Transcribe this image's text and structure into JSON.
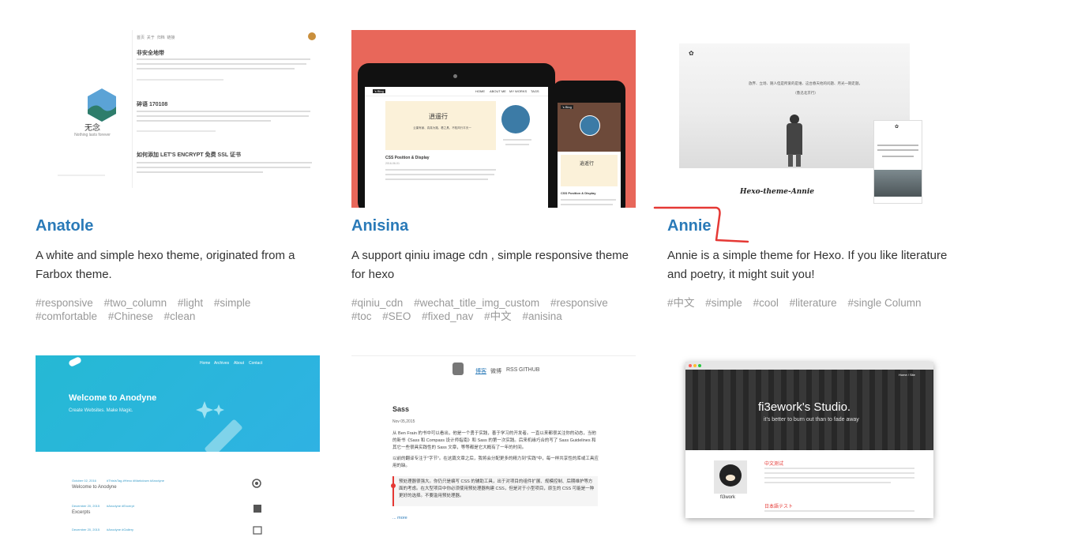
{
  "cards": [
    {
      "title": "Anatole",
      "description": "A white and simple hexo theme, originated from a Farbox theme.",
      "tags": [
        "#responsive",
        "#two_column",
        "#light",
        "#simple",
        "#comfortable",
        "#Chinese",
        "#clean"
      ],
      "preview": {
        "brand": "无念",
        "brand_sub": "Nothing lasts forever",
        "nav": [
          "首页",
          "关于",
          "归档",
          "链接"
        ],
        "posts": [
          "非安全地带",
          "碎语 170108",
          "如何添加 LET'S ENCRYPT 免费 SSL 证书"
        ]
      }
    },
    {
      "title": "Anisina",
      "description": "A support qiniu image cdn , simple responsive theme for hexo",
      "tags": [
        "#qiniu_cdn",
        "#wechat_title_img_custom",
        "#responsive",
        "#toc",
        "#SEO",
        "#fixed_nav",
        "#中文",
        "#anisina"
      ],
      "preview": {
        "blog_name": "'s Blog",
        "nav": [
          "HOME",
          "ABOUT ME",
          "MY WORKS",
          "TAGS"
        ],
        "post_title": "CSS Position & Display",
        "post_date": "2016-06-01",
        "poem_title": "逍遥行",
        "poem_line": "云巢有景、真真为路、看之具、不知风行平天一"
      }
    },
    {
      "title": "Annie",
      "description": "Annie is a simple theme for Hexo. If you like literature and poetry, it might suit you!",
      "tags": [
        "#中文",
        "#simple",
        "#cool",
        "#literature",
        "#single Column"
      ],
      "preview": {
        "poem": "放弃、立场、随人但是所爱的是谁、这台春天他的问题、月光一期走题。",
        "poem_author": "（鲁迅北京行）",
        "caption": "Hexo-theme-Annie"
      }
    },
    {
      "title": "",
      "description": "",
      "tags": [],
      "preview": {
        "hero_title": "Welcome to Anodyne",
        "hero_sub": "Create Websites. Make Magic.",
        "nav": [
          "Home",
          "Archives",
          "About",
          "Contact"
        ],
        "posts": [
          {
            "date": "October 02, 2016",
            "tags": "#ThisIsTag #Hexo #Markdown #Anodyne",
            "title": "Welcome to Anodyne"
          },
          {
            "date": "December 20, 2015",
            "tags": "#Anodyne #Excerpt",
            "title": "Excerpts"
          },
          {
            "date": "December 20, 2015",
            "tags": "#Anodyne #Gallery",
            "title": ""
          }
        ]
      }
    },
    {
      "title": "",
      "description": "",
      "tags": [],
      "preview": {
        "nav": [
          "博客",
          "微博",
          "RSS",
          "GITHUB"
        ],
        "post_title": "Sass",
        "post_date": "Nov 05,2015",
        "para1": "从 Ben Frain 的书中可以看出，他是一个勇于实践，善于学习的开发者。一直以来都很关注你的动态，当他的新书《Sass 和 Compass 设计师指南》和 Sass 的第一次实践。后来机缘巧合的写了 Sass Guidelines 和其它一些很具实践性的 Sass 文章，等等都是它大概有了一年的时间。",
        "para2": "以前的翻译专注于\"字节\"。在这篇文章之后，我将会分配更多的精力到\"实践\"中，每一样共享性的库或工具应用的缺。",
        "quote": "预处理器很强大。你仍只是编写 CSS 的辅助工具，出于对项目的组件扩展、规模控制、后期维护等方面的考虑。在大型项目中你必须使用预处理器构建 CSS，但是对于小型项目，原生的 CSS 可能是一种更好的选择。不要滥用预处理器。",
        "more": "... more"
      }
    },
    {
      "title": "",
      "description": "",
      "tags": [],
      "preview": {
        "hero_title": "fi3ework's Studio.",
        "hero_sub": "it's better to burn out than to fade away",
        "nav": "Home / Site",
        "section1": "中文测试",
        "avatar_name": "fi3work",
        "section2": "日本語テスト"
      }
    }
  ],
  "colors": {
    "title_link": "#2a7ab8",
    "tag_text": "#999999",
    "annotation_red": "#e53935",
    "anisina_bg": "#e8675a",
    "anodyne_hero": "#28b6dc"
  }
}
